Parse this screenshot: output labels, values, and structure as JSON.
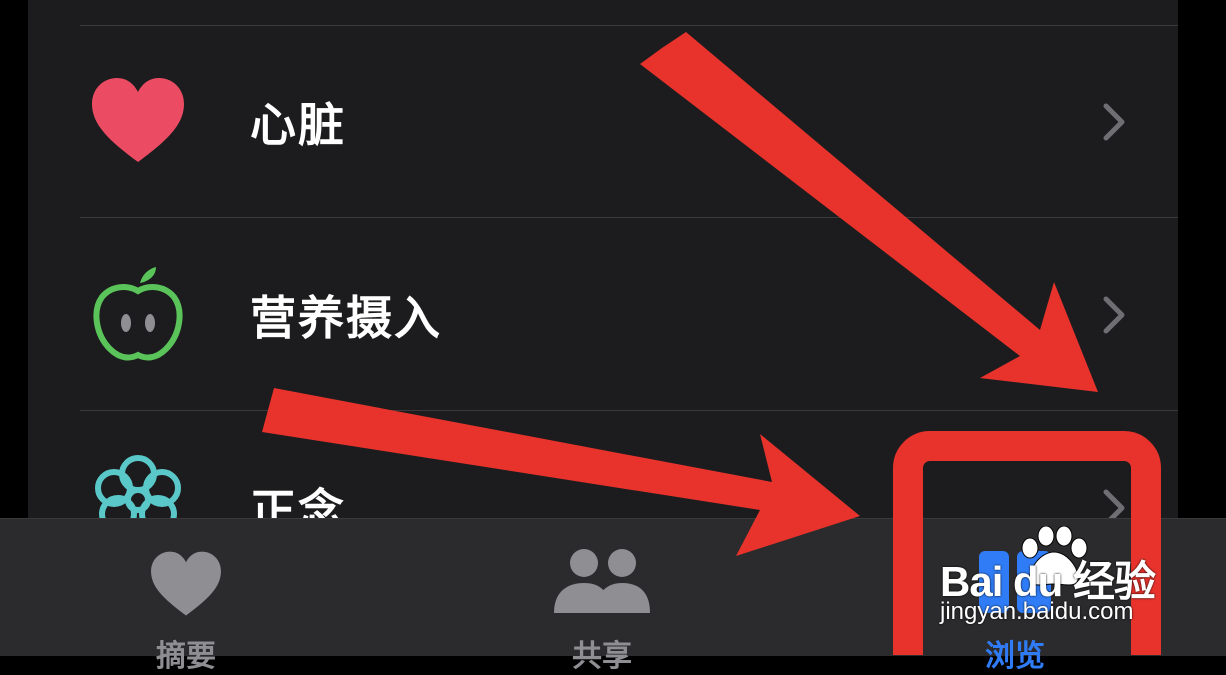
{
  "list": {
    "items": [
      {
        "label": "心脏",
        "icon": "heart-icon",
        "color": "#ec4c63"
      },
      {
        "label": "营养摄入",
        "icon": "apple-icon",
        "color": "#5ac45a"
      },
      {
        "label": "正念",
        "icon": "mindfulness-icon",
        "color": "#5ac8c8"
      }
    ]
  },
  "tabbar": {
    "tabs": [
      {
        "label": "摘要",
        "icon": "heart-icon"
      },
      {
        "label": "共享",
        "icon": "people-icon"
      },
      {
        "label": "浏览",
        "icon": "browse-grid-icon",
        "active": true
      }
    ],
    "active_color": "#2f7cf6",
    "inactive_color": "#8e8e93"
  },
  "annotation": {
    "color": "#e8332c"
  },
  "watermark": {
    "brand": "Bai du 经验",
    "site": "jingyan.baidu.com"
  }
}
